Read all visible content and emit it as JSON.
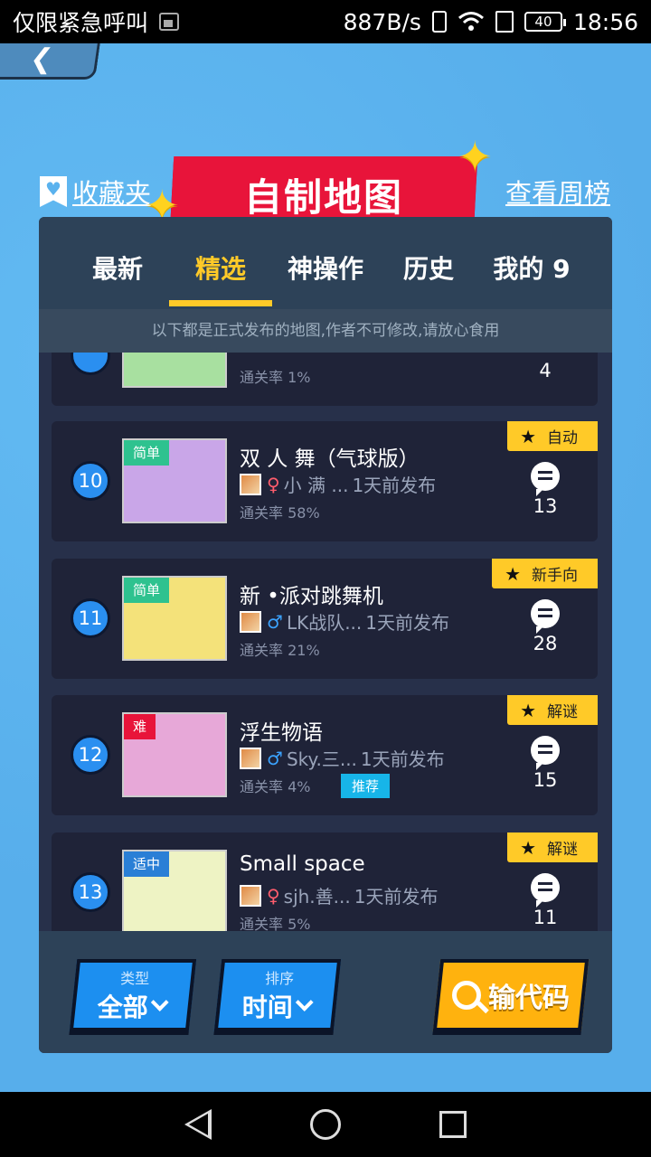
{
  "status": {
    "carrier": "仅限紧急呼叫",
    "speed": "887B/s",
    "battery": "40",
    "time": "18:56"
  },
  "header": {
    "favorites": "收藏夹",
    "title": "自制地图",
    "weekly": "查看周榜"
  },
  "tabs": [
    {
      "label": "最新"
    },
    {
      "label": "精选"
    },
    {
      "label": "神操作"
    },
    {
      "label": "历史"
    },
    {
      "label": "我的 9"
    }
  ],
  "notice": "以下都是正式发布的地图,作者不可修改,请放心食用",
  "partial_item": {
    "pass_rate": "通关率 1%",
    "comments": "4"
  },
  "maps": [
    {
      "rank": "10",
      "difficulty": "简单",
      "diff_color": "#2ec28f",
      "title": "双 人 舞（气球版）",
      "gender": "♀",
      "author": "小 满 ...",
      "published": "1天前发布",
      "pass_rate": "通关率 58%",
      "tag": "自动",
      "comments": "13",
      "thumb_bg": "#c9a6e8"
    },
    {
      "rank": "11",
      "difficulty": "简单",
      "diff_color": "#2ec28f",
      "title": "新 •派对跳舞机",
      "gender": "♂",
      "author": "LK战队...",
      "published": "1天前发布",
      "pass_rate": "通关率 21%",
      "tag": "新手向",
      "comments": "28",
      "thumb_bg": "#f4e27a"
    },
    {
      "rank": "12",
      "difficulty": "难",
      "diff_color": "#e8143a",
      "title": "浮生物语",
      "gender": "♂",
      "author": "Sky.三...",
      "published": "1天前发布",
      "pass_rate": "通关率 4%",
      "recommend": "推荐",
      "tag": "解谜",
      "comments": "15",
      "thumb_bg": "#e7a8d8"
    },
    {
      "rank": "13",
      "difficulty": "适中",
      "diff_color": "#2a7fd6",
      "title": "Small space",
      "gender": "♀",
      "author": "sjh.善...",
      "published": "1天前发布",
      "pass_rate": "通关率 5%",
      "tag": "解谜",
      "comments": "11",
      "thumb_bg": "#eef3c4"
    }
  ],
  "bottom": {
    "type_label": "类型",
    "type_value": "全部",
    "sort_label": "排序",
    "sort_value": "时间",
    "code_label": "输代码"
  },
  "colors": {
    "accent": "#ffca28",
    "banner": "#e8143a",
    "panel": "#27304a",
    "card": "#1f2338"
  }
}
